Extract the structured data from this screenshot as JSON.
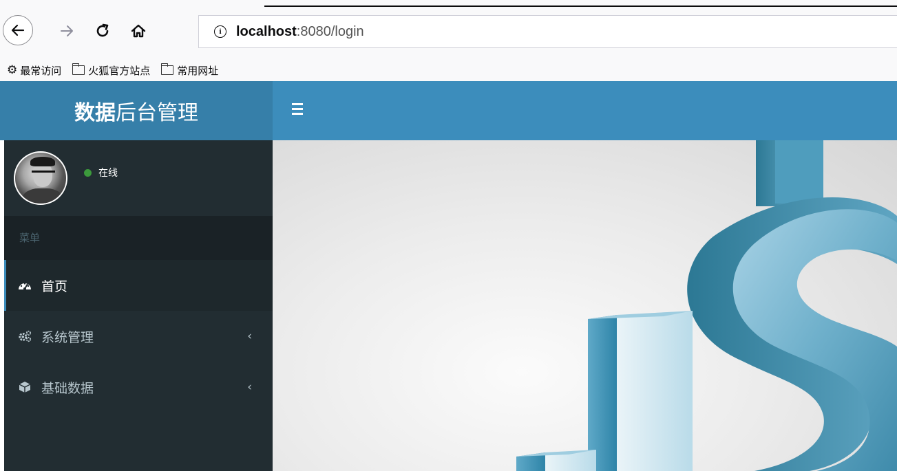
{
  "browser": {
    "url_host": "localhost",
    "url_rest": ":8080/login",
    "bookmarks": [
      {
        "label": "最常访问",
        "icon": "gear-icon"
      },
      {
        "label": "火狐官方站点",
        "icon": "folder-icon"
      },
      {
        "label": "常用网址",
        "icon": "folder-icon"
      }
    ]
  },
  "app": {
    "logo_bold": "数据",
    "logo_light": "后台管理",
    "user_status": "在线",
    "menu_header": "菜单",
    "menu": [
      {
        "label": "首页",
        "icon": "dashboard-icon",
        "active": true
      },
      {
        "label": "系统管理",
        "icon": "cogs-icon",
        "chevron": "‹"
      },
      {
        "label": "基础数据",
        "icon": "cube-icon",
        "chevron": "‹"
      }
    ]
  },
  "colors": {
    "header_primary": "#3c8dbc",
    "logo_bg": "#367fa9",
    "sidebar_bg": "#222d32",
    "status_online": "#3c9a3c"
  }
}
